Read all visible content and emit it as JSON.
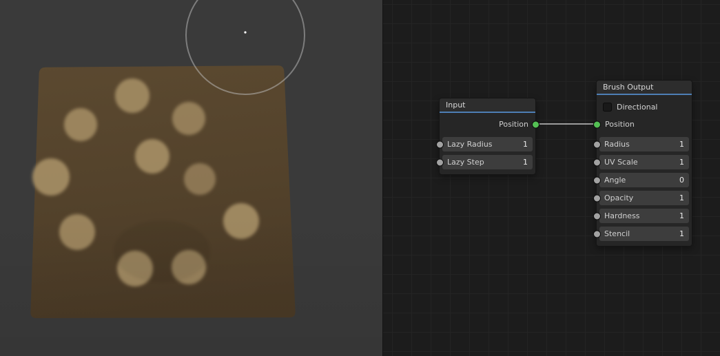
{
  "colors": {
    "accent_blue": "#4e7fb6",
    "socket_green": "#54c054",
    "socket_gray": "#a2a2a2",
    "wire": "#c6c6c6",
    "canvas_brown": "#53422b",
    "paint_dot_tan": "#a28b63"
  },
  "input_node": {
    "title": "Input",
    "output_label": "Position",
    "fields": [
      {
        "label": "Lazy Radius",
        "value": "1"
      },
      {
        "label": "Lazy Step",
        "value": "1"
      }
    ]
  },
  "brush_output_node": {
    "title": "Brush Output",
    "directional_label": "Directional",
    "directional_checked": false,
    "input_label": "Position",
    "fields": [
      {
        "label": "Radius",
        "value": "1"
      },
      {
        "label": "UV Scale",
        "value": "1"
      },
      {
        "label": "Angle",
        "value": "0"
      },
      {
        "label": "Opacity",
        "value": "1"
      },
      {
        "label": "Hardness",
        "value": "1"
      },
      {
        "label": "Stencil",
        "value": "1"
      }
    ]
  }
}
